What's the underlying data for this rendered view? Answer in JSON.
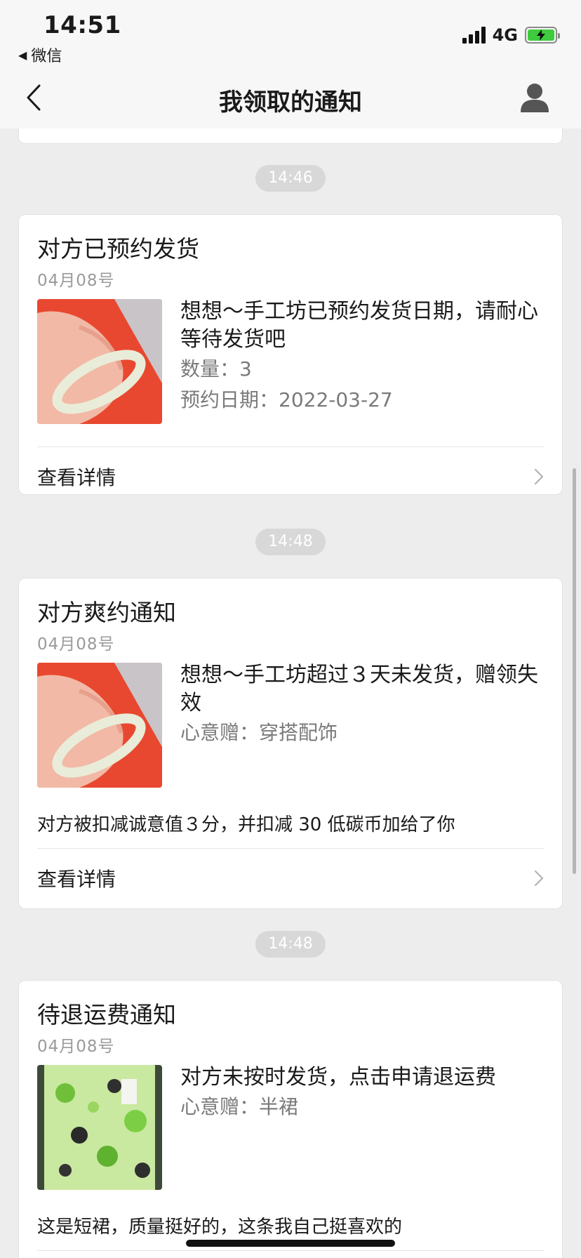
{
  "status_bar": {
    "time": "14:51",
    "back_app": "微信",
    "network": "4G"
  },
  "nav": {
    "title": "我领取的通知"
  },
  "notices": [
    {
      "time": "14:46",
      "title": "对方已预约发货",
      "date": "04月08号",
      "main_text": "想想～手工坊已预约发货日期，请耐心等待发货吧",
      "sub_lines": [
        "数量：3",
        "预约日期：2022-03-27"
      ],
      "note": "",
      "detail_label": "查看详情"
    },
    {
      "time": "14:48",
      "title": "对方爽约通知",
      "date": "04月08号",
      "main_text": "想想～手工坊超过３天未发货，赠领失效",
      "sub_lines": [
        "心意赠：穿搭配饰"
      ],
      "note": "对方被扣减诚意值３分，并扣减 30 低碳币加给了你",
      "detail_label": "查看详情"
    },
    {
      "time": "14:48",
      "title": "待退运费通知",
      "date": "04月08号",
      "main_text": "对方未按时发货，点击申请退运费",
      "sub_lines": [
        "心意赠：半裙"
      ],
      "note": "这是短裙，质量挺好的，这条我自己挺喜欢的",
      "detail_label": ""
    }
  ],
  "colors": {
    "background": "#ededed",
    "card": "#ffffff",
    "time_pill": "#d8d8d8",
    "battery": "#3ecb3e"
  },
  "icons": [
    "back-chevron-icon",
    "user-avatar-icon",
    "chevron-right-icon",
    "signal-icon",
    "battery-icon"
  ]
}
